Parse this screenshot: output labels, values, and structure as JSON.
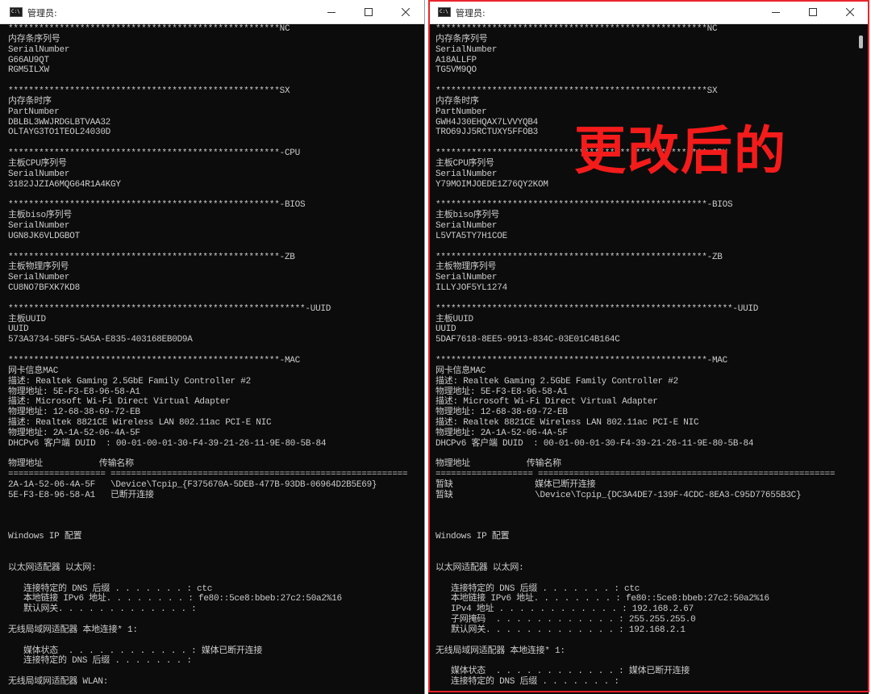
{
  "left_window": {
    "title": "管理员:",
    "console_text": "*****************************************************NC\n内存条序列号\nSerialNumber\nG66AU9QT\nRGM5ILXW\n\n*****************************************************SX\n内存条时序\nPartNumber\nDBLBL3WWJRDGLBTVAA32\nOLTAYG3TO1TEOL24030D\n\n*****************************************************-CPU\n主板CPU序列号\nSerialNumber\n3182JJZIA6MQG64R1A4KGY\n\n*****************************************************-BIOS\n主板biso序列号\nSerialNumber\nUGN8JK6VLDGBOT\n\n*****************************************************-ZB\n主板物理序列号\nSerialNumber\nCU8NO7BFXK7KD8\n\n**********************************************************-UUID\n主板UUID\nUUID\n573A3734-5BF5-5A5A-E835-403168EB0D9A\n\n*****************************************************-MAC\n网卡信息MAC\n描述: Realtek Gaming 2.5GbE Family Controller #2\n物理地址: 5E-F3-E8-96-58-A1\n描述: Microsoft Wi-Fi Direct Virtual Adapter\n物理地址: 12-68-38-69-72-EB\n描述: Realtek 8821CE Wireless LAN 802.11ac PCI-E NIC\n物理地址: 2A-1A-52-06-4A-5F\nDHCPv6 客户端 DUID  : 00-01-00-01-30-F4-39-21-26-11-9E-80-5B-84\n\n物理地址           传输名称\n=================== ==========================================================\n2A-1A-52-06-4A-5F   \\Device\\Tcpip_{F375670A-5DEB-477B-93DB-06964D2B5E69}\n5E-F3-E8-96-58-A1   已断开连接\n\n\n\nWindows IP 配置\n\n\n以太网适配器 以太网:\n\n   连接特定的 DNS 后缀 . . . . . . . : ctc\n   本地链接 IPv6 地址. . . . . . . . : fe80::5ce8:bbeb:27c2:50a2%16\n   默认网关. . . . . . . . . . . . . :\n\n无线局域网适配器 本地连接* 1:\n\n   媒体状态  . . . . . . . . . . . . : 媒体已断开连接\n   连接特定的 DNS 后缀 . . . . . . . :\n\n无线局域网适配器 WLAN:"
  },
  "right_window": {
    "title": "管理员:",
    "console_text": "*****************************************************NC\n内存条序列号\nSerialNumber\nA18ALLFP\nTG5VM9QO\n\n*****************************************************SX\n内存条时序\nPartNumber\nGWH4J30EHQAX7LVVYQB4\nTRO69JJ5RCTUXY5FFOB3\n\n*****************************************************-CPU\n主板CPU序列号\nSerialNumber\nY79MOIMJOEDE1Z76QY2KOM\n\n*****************************************************-BIOS\n主板biso序列号\nSerialNumber\nL5VTA5TY7H1COE\n\n*****************************************************-ZB\n主板物理序列号\nSerialNumber\nILLYJOF5YL1274\n\n**********************************************************-UUID\n主板UUID\nUUID\n5DAF7618-8EE5-9913-834C-03E01C4B164C\n\n*****************************************************-MAC\n网卡信息MAC\n描述: Realtek Gaming 2.5GbE Family Controller #2\n物理地址: 5E-F3-E8-96-58-A1\n描述: Microsoft Wi-Fi Direct Virtual Adapter\n物理地址: 12-68-38-69-72-EB\n描述: Realtek 8821CE Wireless LAN 802.11ac PCI-E NIC\n物理地址: 2A-1A-52-06-4A-5F\nDHCPv6 客户端 DUID  : 00-01-00-01-30-F4-39-21-26-11-9E-80-5B-84\n\n物理地址           传输名称\n=================== ==========================================================\n暂缺                媒体已断开连接\n暂缺                \\Device\\Tcpip_{DC3A4DE7-139F-4CDC-8EA3-C95D77655B3C}\n\n\n\nWindows IP 配置\n\n\n以太网适配器 以太网:\n\n   连接特定的 DNS 后缀 . . . . . . . : ctc\n   本地链接 IPv6 地址. . . . . . . . : fe80::5ce8:bbeb:27c2:50a2%16\n   IPv4 地址 . . . . . . . . . . . . : 192.168.2.67\n   子网掩码  . . . . . . . . . . . . : 255.255.255.0\n   默认网关. . . . . . . . . . . . . : 192.168.2.1\n\n无线局域网适配器 本地连接* 1:\n\n   媒体状态  . . . . . . . . . . . . : 媒体已断开连接\n   连接特定的 DNS 后缀 . . . . . . . :"
  },
  "overlay": {
    "label": "更改后的",
    "color": "#f41b1b"
  },
  "icons": {
    "window_icon": "cmd-icon",
    "minimize": "minimize-icon",
    "maximize": "maximize-icon",
    "close": "close-icon"
  },
  "colors": {
    "console_bg": "#0c0c0c",
    "console_text": "#cccccc",
    "highlight_frame": "#e8252a"
  }
}
